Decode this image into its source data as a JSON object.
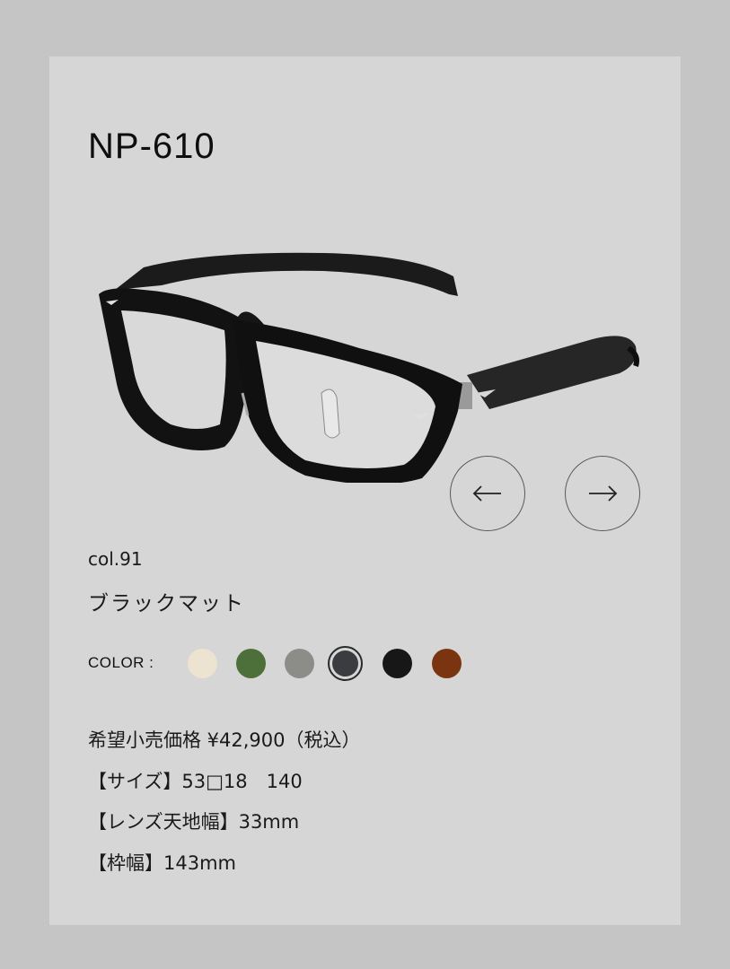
{
  "product": {
    "model": "NP-610",
    "color_code": "col.91",
    "color_name": "ブラックマット"
  },
  "navigation": {
    "prev_arrow": "←",
    "next_arrow": "→"
  },
  "colors": {
    "label": "COLOR :",
    "swatches": [
      {
        "hex": "#ece4d1",
        "selected": false
      },
      {
        "hex": "#4d6f39",
        "selected": false
      },
      {
        "hex": "#8c8c89",
        "selected": false
      },
      {
        "hex": "#3b3c3f",
        "selected": true
      },
      {
        "hex": "#171717",
        "selected": false
      },
      {
        "hex": "#7a3510",
        "selected": false
      }
    ]
  },
  "specs": {
    "price": "希望小売価格 ¥42,900（税込）",
    "size": "【サイズ】53□18　140",
    "lens_height": "【レンズ天地幅】33mm",
    "frame_width": "【枠幅】143mm"
  }
}
